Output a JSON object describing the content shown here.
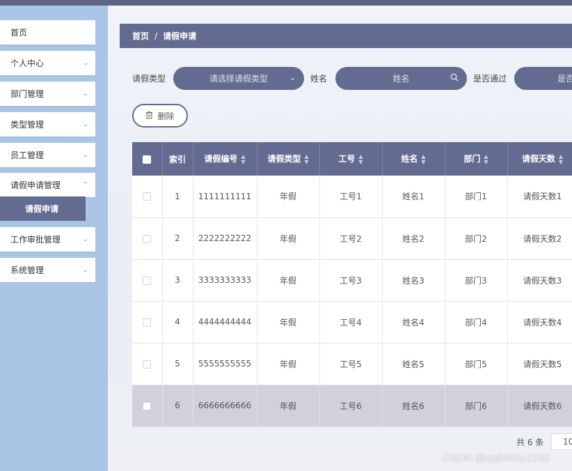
{
  "sidebar": {
    "items": [
      {
        "label": "首页",
        "has_arrow": false
      },
      {
        "label": "个人中心",
        "has_arrow": true
      },
      {
        "label": "部门管理",
        "has_arrow": true
      },
      {
        "label": "类型管理",
        "has_arrow": true
      },
      {
        "label": "员工管理",
        "has_arrow": true
      },
      {
        "label": "请假申请管理",
        "has_arrow": true
      },
      {
        "label": "工作审批管理",
        "has_arrow": true
      },
      {
        "label": "系统管理",
        "has_arrow": true
      }
    ],
    "submenu_active": "请假申请"
  },
  "breadcrumb": {
    "home": "首页",
    "separator": "/",
    "current": "请假申请"
  },
  "filters": {
    "leave_type_label": "请假类型",
    "leave_type_placeholder": "请选择请假类型",
    "name_label": "姓名",
    "name_placeholder": "姓名",
    "approved_label": "是否通过",
    "approved_placeholder": "是否通过"
  },
  "toolbar": {
    "delete_label": "删除"
  },
  "table": {
    "columns": [
      "索引",
      "请假编号",
      "请假类型",
      "工号",
      "姓名",
      "部门",
      "请假天数"
    ],
    "rows": [
      [
        "1",
        "1111111111",
        "年假",
        "工号1",
        "姓名1",
        "部门1",
        "请假天数1"
      ],
      [
        "2",
        "2222222222",
        "年假",
        "工号2",
        "姓名2",
        "部门2",
        "请假天数2"
      ],
      [
        "3",
        "3333333333",
        "年假",
        "工号3",
        "姓名3",
        "部门3",
        "请假天数3"
      ],
      [
        "4",
        "4444444444",
        "年假",
        "工号4",
        "姓名4",
        "部门4",
        "请假天数4"
      ],
      [
        "5",
        "5555555555",
        "年假",
        "工号5",
        "姓名5",
        "部门5",
        "请假天数5"
      ],
      [
        "6",
        "6666666666",
        "年假",
        "工号6",
        "姓名6",
        "部门6",
        "请假天数6"
      ]
    ],
    "highlighted_row": 6
  },
  "pagination": {
    "total_text": "共 6 条",
    "page_size": "10"
  },
  "watermark": "CSDN @qq840612233",
  "colors": {
    "accent": "#646b90",
    "sidebar_bg": "#a9c6e6",
    "row_highlight": "#d0d1dd"
  }
}
